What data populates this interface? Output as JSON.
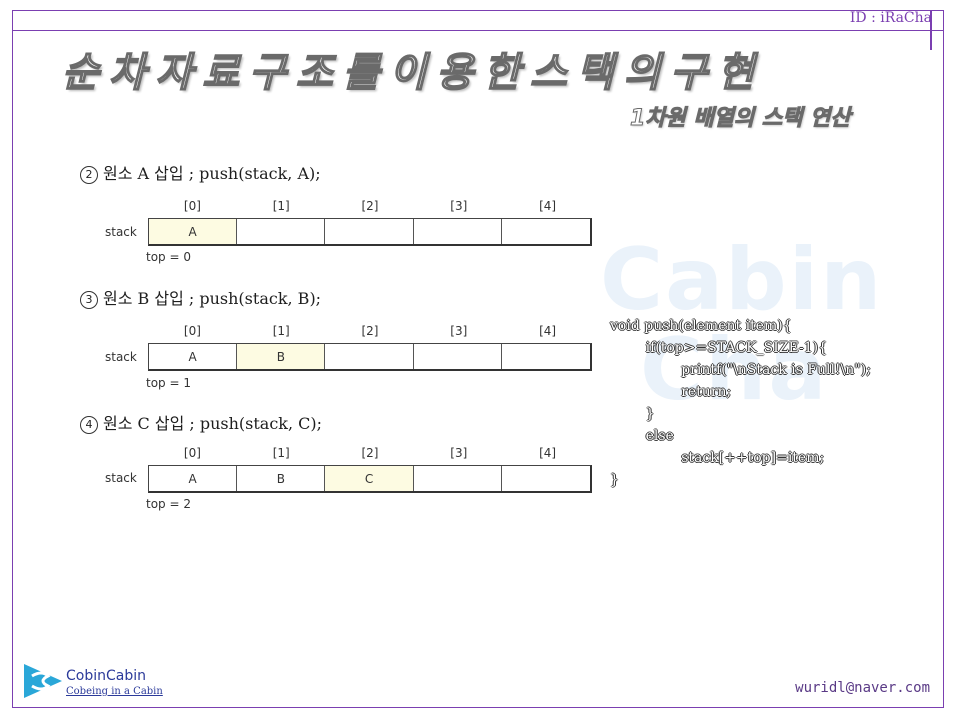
{
  "header": {
    "id_label": "ID : iRaCha"
  },
  "title": "순차자료구조를이용한스택의구현",
  "subtitle": "1차원 배열의 스택 연산",
  "watermark": "Cabin\nCha",
  "steps": [
    {
      "number": "2",
      "label": "원소 A 삽입 ; push(stack, A);",
      "stack_label": "stack",
      "indices": [
        "[0]",
        "[1]",
        "[2]",
        "[3]",
        "[4]"
      ],
      "cells": [
        "A",
        "",
        "",
        "",
        ""
      ],
      "highlight_index": 0,
      "top_label": "top = 0"
    },
    {
      "number": "3",
      "label": "원소 B 삽입 ; push(stack, B);",
      "stack_label": "stack",
      "indices": [
        "[0]",
        "[1]",
        "[2]",
        "[3]",
        "[4]"
      ],
      "cells": [
        "A",
        "B",
        "",
        "",
        ""
      ],
      "highlight_index": 1,
      "top_label": "top = 1"
    },
    {
      "number": "4",
      "label": "원소 C 삽입 ; push(stack, C);",
      "stack_label": "stack",
      "indices": [
        "[0]",
        "[1]",
        "[2]",
        "[3]",
        "[4]"
      ],
      "cells": [
        "A",
        "B",
        "C",
        "",
        ""
      ],
      "highlight_index": 2,
      "top_label": "top = 2"
    }
  ],
  "code_lines": [
    "void push(element item){",
    "        if(top>=STACK_SIZE-1){",
    "                printf(\"\\nStack is Full!\\n\");",
    "                return;",
    "        }",
    "        else",
    "                stack[++top]=item;",
    "}"
  ],
  "footer": {
    "brand": "CobinCabin",
    "tagline": "Cobeing in a Cabin",
    "email": "wuridl@naver.com"
  },
  "colors": {
    "frame": "#7b3fb1",
    "highlight": "#fdfbe2",
    "brand": "#2b3a9a"
  },
  "icons": {
    "logo": "cobincabin-logo-icon"
  }
}
